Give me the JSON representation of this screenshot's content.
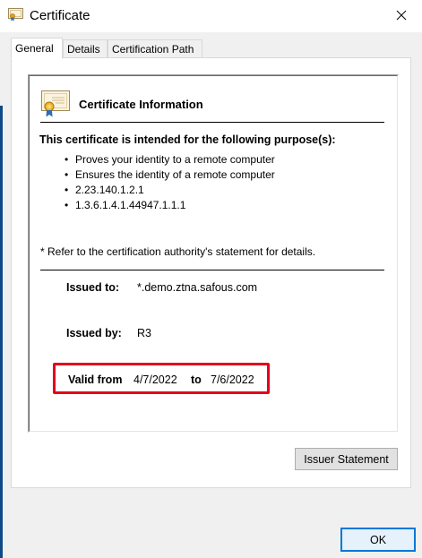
{
  "window": {
    "title": "Certificate",
    "icons": {
      "title": "certificate-icon",
      "close": "close-icon"
    }
  },
  "tabs": [
    {
      "label": "General",
      "active": true
    },
    {
      "label": "Details",
      "active": false
    },
    {
      "label": "Certification Path",
      "active": false
    }
  ],
  "general": {
    "heading": "Certificate Information",
    "purpose_heading": "This certificate is intended for the following purpose(s):",
    "purposes": [
      "Proves your identity to a remote computer",
      "Ensures the identity of a remote computer",
      "2.23.140.1.2.1",
      "1.3.6.1.4.1.44947.1.1.1"
    ],
    "refer_note": "* Refer to the certification authority's statement for details.",
    "issued_to_label": "Issued to:",
    "issued_to_value": "*.demo.ztna.safous.com",
    "issued_by_label": "Issued by:",
    "issued_by_value": "R3",
    "valid_from_label": "Valid from",
    "valid_from_value": "4/7/2022",
    "valid_to_label": "to",
    "valid_to_value": "7/6/2022",
    "highlight_color": "#e3001b"
  },
  "buttons": {
    "issuer_statement": "Issuer Statement",
    "ok": "OK"
  },
  "colors": {
    "accent": "#0078d7"
  }
}
